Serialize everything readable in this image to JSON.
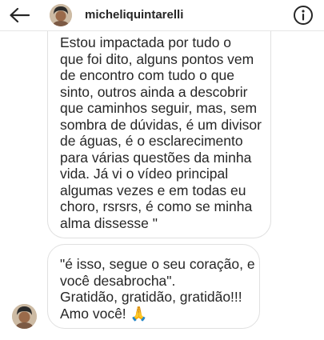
{
  "header": {
    "username": "micheliquintarelli",
    "back_icon": "back-arrow-icon",
    "info_icon": "info-icon"
  },
  "messages": [
    {
      "lines": [
        "Estou impactada por tudo o",
        "que foi dito, alguns pontos vem",
        "de encontro com tudo o que",
        "sinto, outros ainda a descobrir",
        "que caminhos seguir, mas, sem",
        "sombra de dúvidas, é um divisor",
        "de águas, é o esclarecimento",
        "para várias questões da minha",
        "vida. Já vi o vídeo principal",
        "algumas vezes e em todas eu",
        "choro, rsrsrs, é como se minha",
        "alma dissesse \""
      ]
    },
    {
      "lines": [
        "\"é isso, segue o seu coração, e",
        "você desabrocha\".",
        "Gratidão, gratidão, gratidão!!!",
        "Amo você! 🙏"
      ]
    }
  ],
  "colors": {
    "background": "#ffffff",
    "text": "#262626",
    "bubble_border": "#e0e0e0"
  }
}
